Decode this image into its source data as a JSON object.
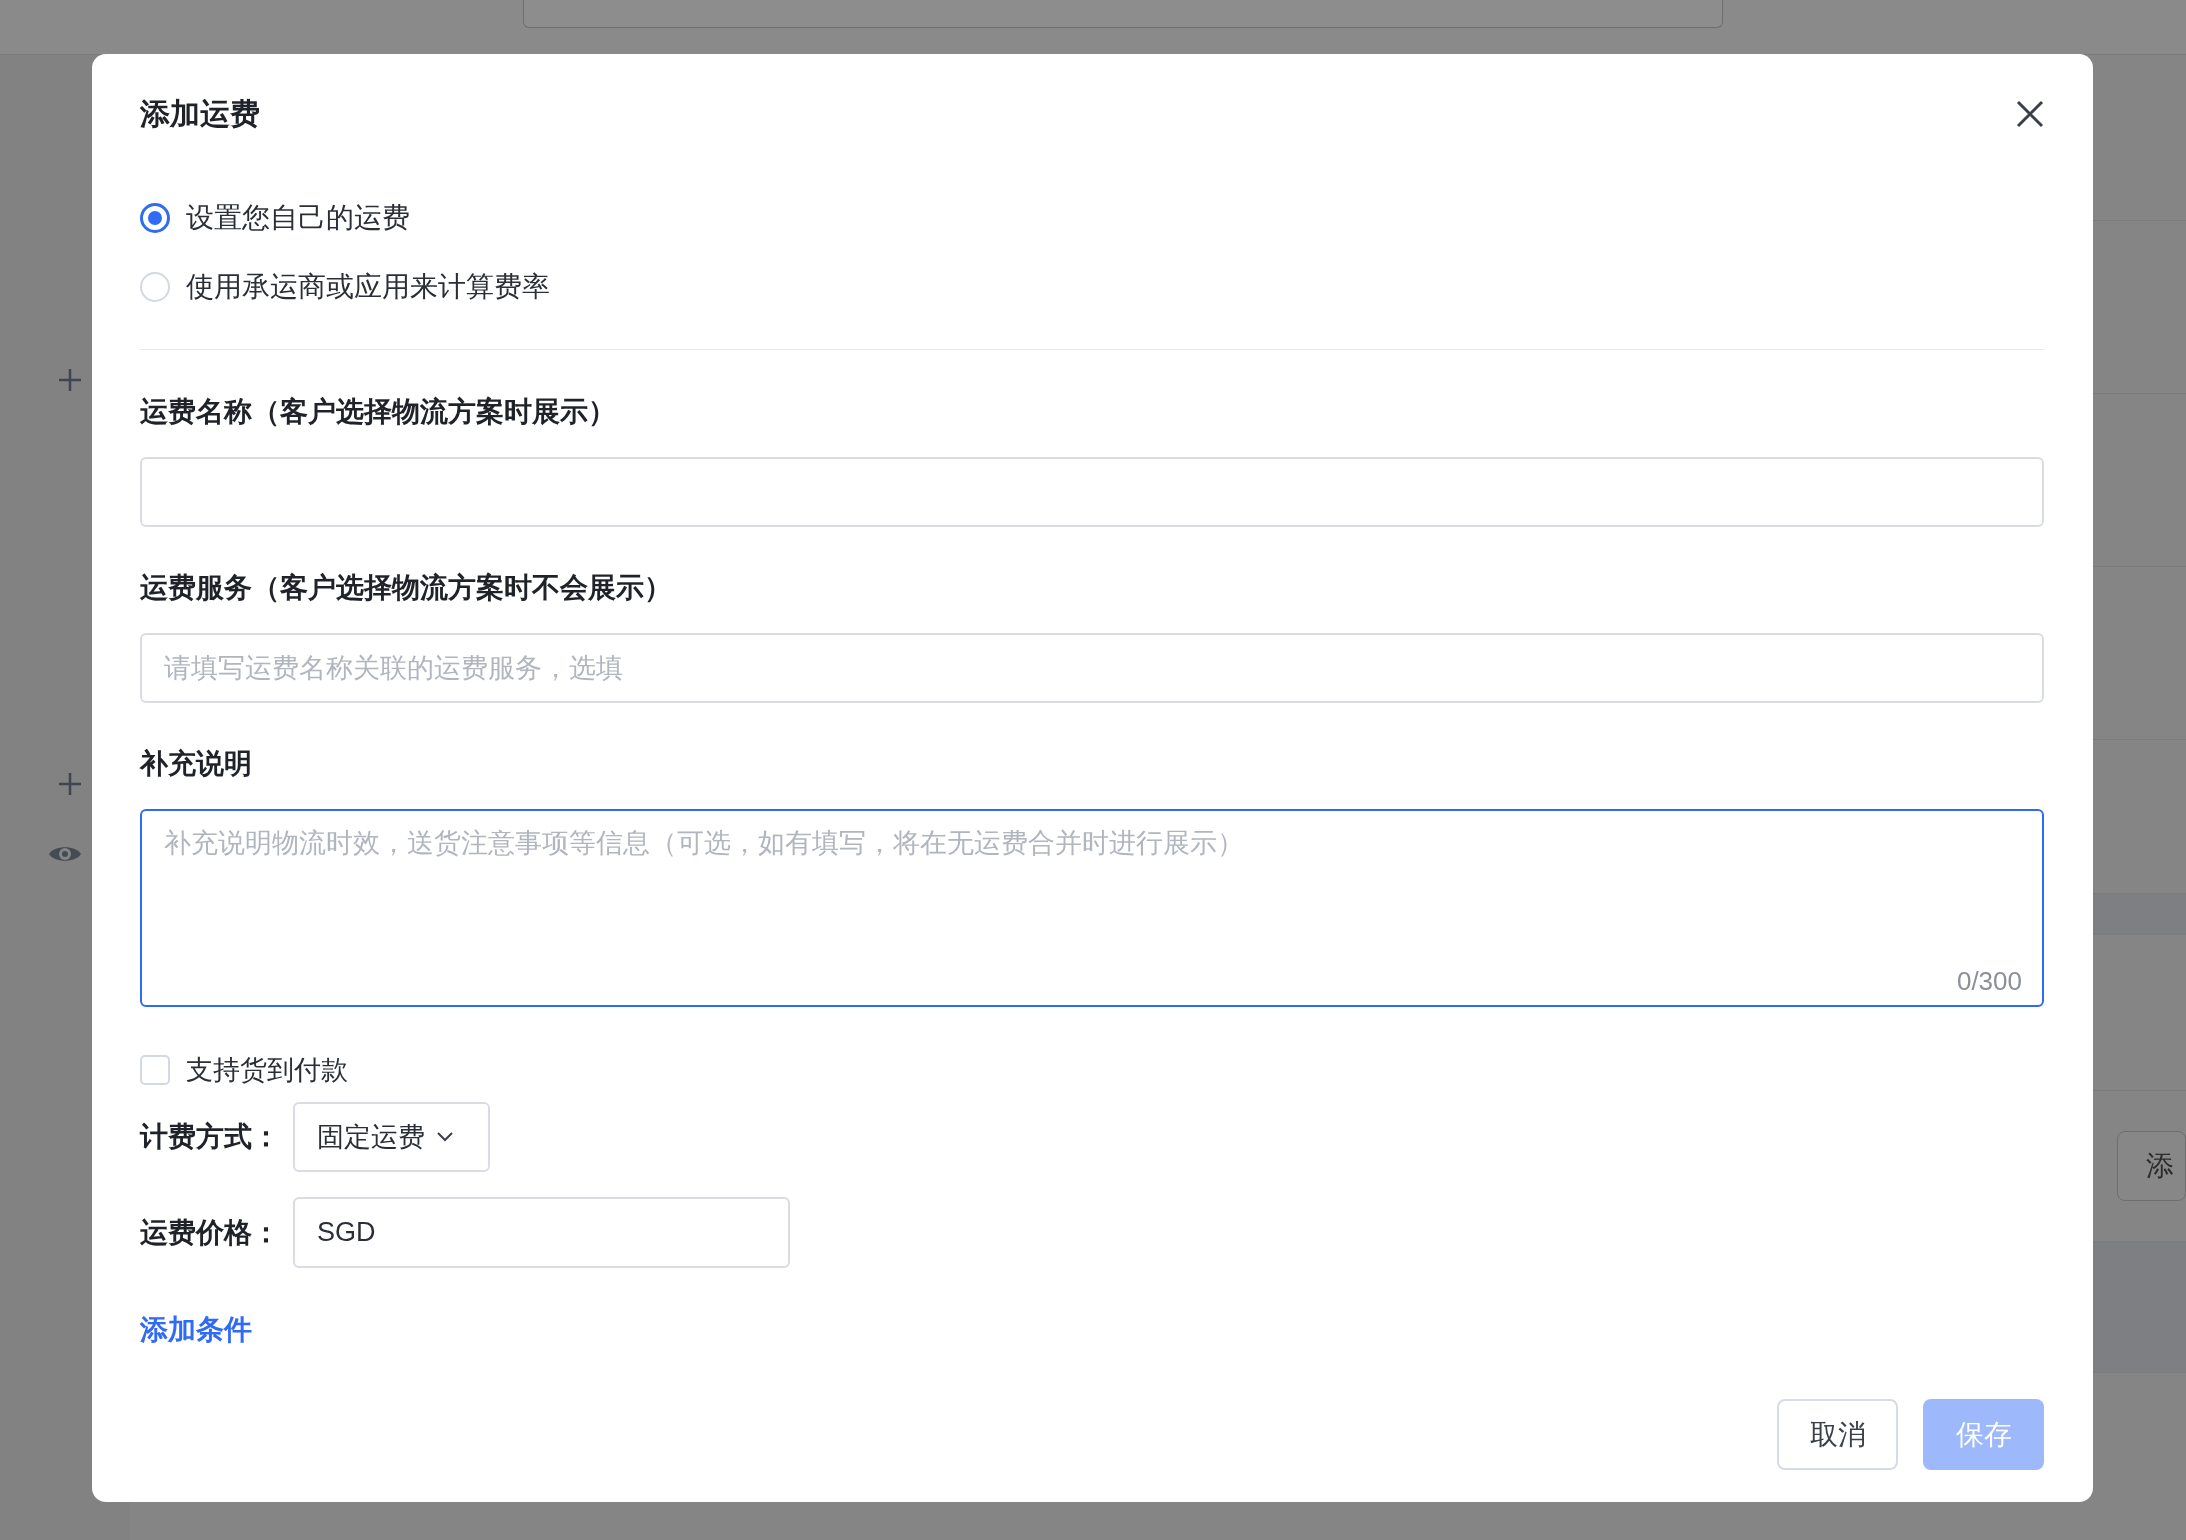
{
  "background": {
    "side_button": "添"
  },
  "dialog": {
    "title": "添加运费",
    "options": [
      {
        "label": "设置您自己的运费",
        "selected": true
      },
      {
        "label": "使用承运商或应用来计算费率",
        "selected": false
      }
    ],
    "name_field": {
      "label": "运费名称（客户选择物流方案时展示）"
    },
    "service_field": {
      "label": "运费服务（客户选择物流方案时不会展示）",
      "placeholder": "请填写运费名称关联的运费服务，选填"
    },
    "note_field": {
      "label": "补充说明",
      "placeholder": "补充说明物流时效，送货注意事项等信息（可选，如有填写，将在无运费合并时进行展示）",
      "counter": "0/300",
      "focused": true
    },
    "cod": {
      "label": "支持货到付款",
      "checked": false
    },
    "billing": {
      "label": "计费方式：",
      "value": "固定运费"
    },
    "price": {
      "label": "运费价格：",
      "value": "SGD"
    },
    "add_condition": "添加条件",
    "buttons": [
      {
        "label": "取消",
        "kind": "secondary",
        "disabled": false
      },
      {
        "label": "保存",
        "kind": "primary",
        "disabled": true
      }
    ]
  }
}
